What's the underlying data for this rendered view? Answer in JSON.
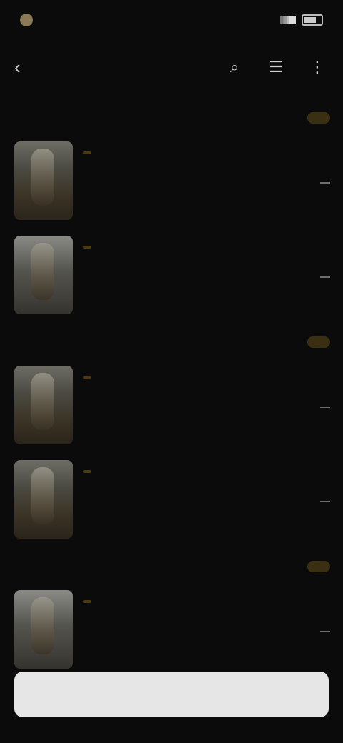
{
  "status": {
    "time": "",
    "icons": [
      "signal-icon",
      "battery-icon"
    ]
  },
  "app_bar": {
    "title": "",
    "actions": [
      "search-icon",
      "filter-icon",
      "more-icon"
    ]
  },
  "sections": [
    {
      "date": "",
      "pill": "",
      "items": [
        {
          "badge": "",
          "title": "",
          "meta": "",
          "sub": ""
        },
        {
          "badge": "",
          "title": "",
          "meta": "",
          "sub": ""
        }
      ]
    },
    {
      "date": "",
      "pill": "",
      "items": [
        {
          "badge": "",
          "title": "",
          "meta": "",
          "sub": ""
        },
        {
          "badge": "",
          "title": "",
          "meta": "",
          "sub": ""
        }
      ]
    },
    {
      "date": "",
      "pill": "",
      "items": [
        {
          "badge": "",
          "title": "",
          "meta": "",
          "sub": ""
        }
      ]
    }
  ],
  "bottom_button": {
    "label": ""
  }
}
